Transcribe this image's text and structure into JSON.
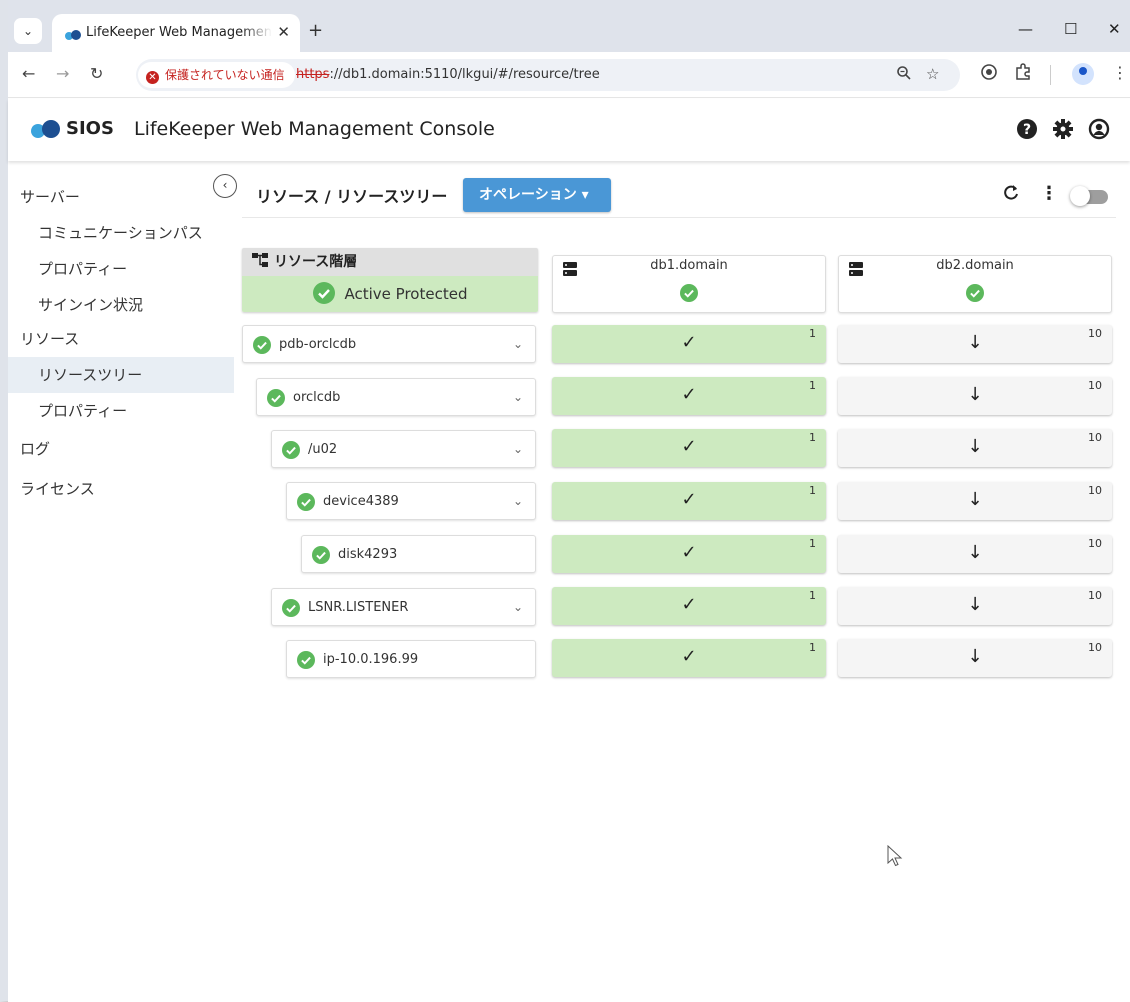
{
  "browser": {
    "tab_title": "LifeKeeper Web Management Console",
    "tab_dropdown": "⌄",
    "tab_close": "✕",
    "new_tab": "+",
    "win_min": "—",
    "win_max": "☐",
    "win_close": "✕",
    "security_label": "保護されていない通信",
    "url_scheme": "https",
    "url_rest": "://db1.domain:5110/lkgui/#/resource/tree"
  },
  "app": {
    "brand": "SIOS",
    "title": "LifeKeeper Web Management Console"
  },
  "sidebar": {
    "items": [
      {
        "label": "サーバー"
      },
      {
        "label": "コミュニケーションパス"
      },
      {
        "label": "プロパティー"
      },
      {
        "label": "サインイン状況"
      },
      {
        "label": "リソース"
      },
      {
        "label": "リソースツリー"
      },
      {
        "label": "プロパティー"
      },
      {
        "label": "ログ"
      },
      {
        "label": "ライセンス"
      }
    ]
  },
  "main": {
    "breadcrumb": "リソース / リソースツリー",
    "operation_button": "オペレーション ▾",
    "hierarchy_header": "リソース階層",
    "hierarchy_status": "Active Protected",
    "servers": [
      {
        "name": "db1.domain"
      },
      {
        "name": "db2.domain"
      }
    ],
    "resources": [
      {
        "name": "pdb-orclcdb",
        "db1": "✓",
        "db1_priority": "1",
        "db2": "↓",
        "db2_priority": "10"
      },
      {
        "name": "orclcdb",
        "db1": "✓",
        "db1_priority": "1",
        "db2": "↓",
        "db2_priority": "10"
      },
      {
        "name": "/u02",
        "db1": "✓",
        "db1_priority": "1",
        "db2": "↓",
        "db2_priority": "10"
      },
      {
        "name": "device4389",
        "db1": "✓",
        "db1_priority": "1",
        "db2": "↓",
        "db2_priority": "10"
      },
      {
        "name": "disk4293",
        "db1": "✓",
        "db1_priority": "1",
        "db2": "↓",
        "db2_priority": "10"
      },
      {
        "name": "LSNR.LISTENER",
        "db1": "✓",
        "db1_priority": "1",
        "db2": "↓",
        "db2_priority": "10"
      },
      {
        "name": "ip-10.0.196.99",
        "db1": "✓",
        "db1_priority": "1",
        "db2": "↓",
        "db2_priority": "10"
      }
    ]
  },
  "colors": {
    "active_green": "#cdeac0",
    "check_green": "#5cb85c",
    "operation_blue": "#4a97d6",
    "insecure_red": "#c5221f"
  }
}
